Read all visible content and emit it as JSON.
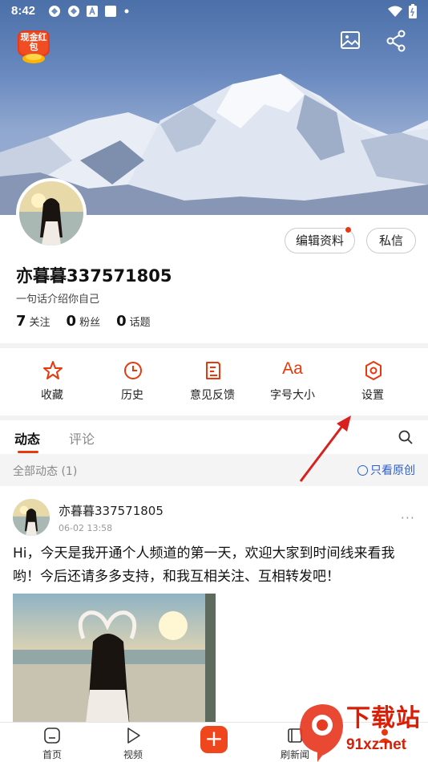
{
  "status_bar": {
    "time": "8:42",
    "icons": [
      "sync-icon",
      "sync-icon",
      "font-a-icon",
      "square-icon",
      "dot-icon"
    ],
    "right_icons": [
      "wifi-icon",
      "battery-icon"
    ]
  },
  "header": {
    "red_packet_label": "现金红包",
    "icons": [
      "image-icon",
      "share-icon"
    ]
  },
  "profile": {
    "edit_label": "编辑资料",
    "message_label": "私信",
    "username": "亦暮暮337571805",
    "bio": "一句话介绍你自己",
    "stats": [
      {
        "num": "7",
        "label": "关注"
      },
      {
        "num": "0",
        "label": "粉丝"
      },
      {
        "num": "0",
        "label": "话题"
      }
    ]
  },
  "tools": [
    {
      "icon": "star-icon",
      "label": "收藏"
    },
    {
      "icon": "clock-icon",
      "label": "历史"
    },
    {
      "icon": "feedback-icon",
      "label": "意见反馈"
    },
    {
      "icon": "font-size-icon",
      "label": "字号大小",
      "glyph": "Aa"
    },
    {
      "icon": "settings-icon",
      "label": "设置"
    }
  ],
  "tabs": {
    "items": [
      "动态",
      "评论"
    ],
    "active": "动态"
  },
  "filter": {
    "all_label": "全部动态 (1)",
    "original_only_label": "只看原创"
  },
  "post": {
    "author": "亦暮暮337571805",
    "time": "06-02 13:58",
    "more": "···",
    "text": "Hi，今天是我开通个人频道的第一天，欢迎大家到时间线来看我哟！今后还请多多支持，和我互相关注、互相转发吧！"
  },
  "bottom_nav": [
    {
      "icon": "home-icon",
      "label": "首页"
    },
    {
      "icon": "video-icon",
      "label": "视频"
    },
    {
      "icon": "plus-icon",
      "label": ""
    },
    {
      "icon": "refresh-news-icon",
      "label": "刷新闻"
    },
    {
      "icon": "profile-icon",
      "label": ""
    }
  ],
  "plus_glyph": "+",
  "watermark": {
    "title": "下载站",
    "url": "91xz.net"
  },
  "colors": {
    "accent": "#e8380d",
    "link": "#2f5fcf",
    "arrow": "#d8201e"
  }
}
